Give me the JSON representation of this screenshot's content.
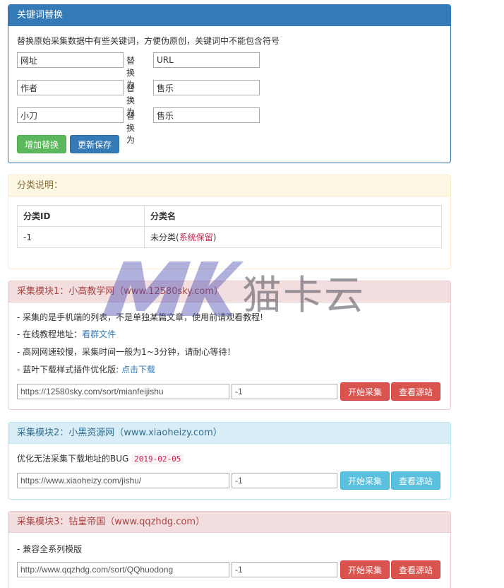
{
  "keyword": {
    "title": "关键词替换",
    "desc": "替换原始采集数据中有些关键词，方便伪原创，关键词中不能包含符号",
    "replace_label": "替换为",
    "rows": [
      {
        "src": "网址",
        "dst": "URL"
      },
      {
        "src": "作者",
        "dst": "售乐"
      },
      {
        "src": "小刀",
        "dst": "售乐"
      }
    ],
    "add_label": "增加替换",
    "save_label": "更新保存"
  },
  "category": {
    "title": "分类说明：",
    "headers": [
      "分类ID",
      "分类名"
    ],
    "row": {
      "id": "-1",
      "name_prefix": "未分类(",
      "name_reserved": "系统保留",
      "name_suffix": ")"
    }
  },
  "module1": {
    "title": "采集模块1：小高教学网（www.12580sky.com）",
    "lines": [
      "- 采集的是手机端的列表，不是单独某篇文章，使用前请观看教程!",
      "- 在线教程地址：",
      "- 高网网速较慢，采集时间一般为1~3分钟，请耐心等待！",
      "- 蓝叶下载样式插件优化版: "
    ],
    "tutorial_link": "看群文件",
    "download_link": "点击下载",
    "url": "https://12580sky.com/sort/mianfeijishu",
    "cid": "-1",
    "start_label": "开始采集",
    "view_label": "查看源站"
  },
  "module2": {
    "title": "采集模块2：小黑资源网（www.xiaoheizy.com）",
    "line": "优化无法采集下载地址的BUG",
    "date": "2019-02-05",
    "url": "https://www.xiaoheizy.com/jishu/",
    "cid": "-1",
    "start_label": "开始采集",
    "view_label": "查看源站"
  },
  "module3": {
    "title": "采集模块3：钻皇帝国（www.qqzhdg.com）",
    "line": "- 兼容全系列模版",
    "url": "http://www.qqzhdg.com/sort/QQhuodong",
    "cid": "-1",
    "start_label": "开始采集",
    "view_label": "查看源站"
  },
  "watermark": {
    "text": "猫卡云"
  }
}
